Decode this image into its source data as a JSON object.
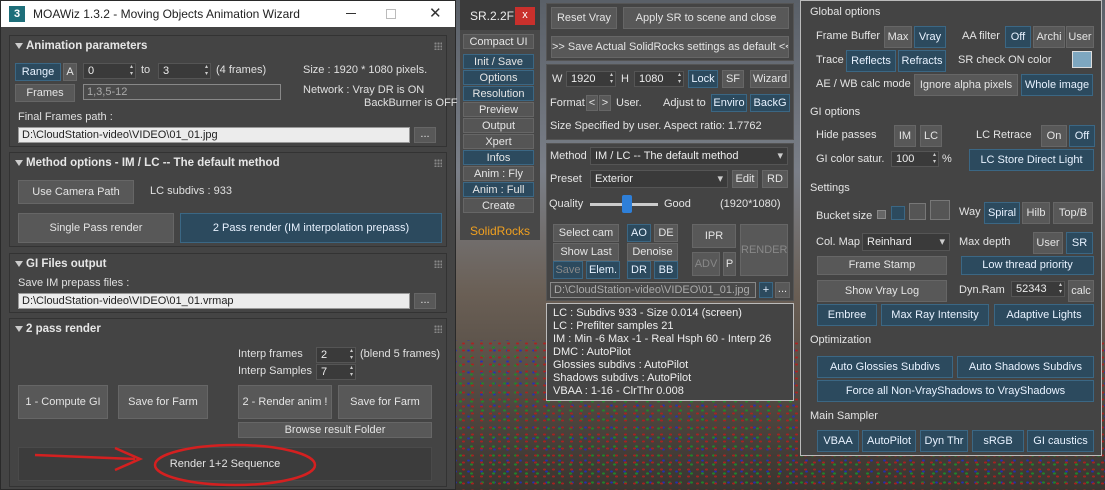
{
  "moawiz": {
    "title": "MOAWiz 1.3.2 - Moving Objects Animation Wizard",
    "app_icon": "3",
    "sections": {
      "anim": "Animation parameters",
      "method": "Method options - IM / LC -- The default method",
      "gi": "GI Files output",
      "two": "2 pass render"
    },
    "range_btn": "Range",
    "a_btn": "A",
    "range_from": "0",
    "to_lbl": "to",
    "range_to": "3",
    "frames_count": "(4 frames)",
    "size_text": "Size : 1920 * 1080 pixels.",
    "frames_btn": "Frames",
    "frames_placeholder": "1,3,5-12",
    "network1": "Network : Vray DR is ON",
    "network2": "BackBurner is OFF",
    "final_path_lbl": "Final Frames path :",
    "final_path": "D:\\CloudStation-video\\VIDEO\\01_01.jpg",
    "browse": "...",
    "use_camera_path": "Use Camera Path",
    "lc_subdivs": "LC subdivs : 933",
    "single_pass": "Single Pass render",
    "two_pass": "2 Pass render (IM interpolation prepass)",
    "save_im_lbl": "Save IM prepass files :",
    "im_path": "D:\\CloudStation-video\\VIDEO\\01_01.vrmap",
    "interp_frames_lbl": "Interp frames",
    "interp_frames": "2",
    "blend": "(blend 5 frames)",
    "interp_samples_lbl": "Interp Samples",
    "interp_samples": "7",
    "compute_gi": "1 - Compute GI",
    "save_farm1": "Save for Farm",
    "render_anim": "2 - Render anim !",
    "save_farm2": "Save for Farm",
    "browse_result": "Browse result Folder",
    "render_seq": "Render 1+2 Sequence"
  },
  "sr": {
    "title": "SR.2.2F",
    "close": "x",
    "items": [
      "Compact UI",
      "Init / Save",
      "Options",
      "Resolution",
      "Preview",
      "Output",
      "Xpert",
      "Infos",
      "Anim : Fly",
      "Anim : Full",
      "Create"
    ],
    "logo": "SolidRocks"
  },
  "mid": {
    "reset": "Reset Vray",
    "apply": "Apply SR to scene and close",
    "save_actual": ">> Save Actual SolidRocks settings as default <<",
    "w_lbl": "W",
    "w": "1920",
    "h_lbl": "H",
    "h": "1080",
    "lock": "Lock",
    "sf": "SF",
    "wizard": "Wizard",
    "format_lbl": "Format",
    "fmt_l": "<",
    "fmt_r": ">",
    "user_lbl": "User.",
    "adjust_lbl": "Adjust to",
    "enviro": "Enviro",
    "backg": "BackG",
    "size_text": "Size  Specified by user. Aspect ratio: 1.7762",
    "method_lbl": "Method",
    "method": "IM / LC -- The default method",
    "preset_lbl": "Preset",
    "preset": "Exterior",
    "edit": "Edit",
    "rd": "RD",
    "quality_lbl": "Quality",
    "good": "Good",
    "res": "(1920*1080)",
    "quality": 0.55,
    "select_cam": "Select cam",
    "ao": "AO",
    "de": "DE",
    "ipr": "IPR",
    "render": "RENDER",
    "show_last": "Show Last",
    "denoise": "Denoise",
    "save": "Save",
    "elem": "Elem.",
    "dr": "DR",
    "bb": "BB",
    "adv": "ADV",
    "p": "P",
    "path": "D:\\CloudStation-video\\VIDEO\\01_01.jpg",
    "plus": "+",
    "dots": "...",
    "info": [
      "LC : Subdivs 933 - Size 0.014 (screen)",
      "LC : Prefilter samples 21",
      "IM : Min -6 Max -1 - Real Hsph 60 - Interp 26",
      "DMC : AutoPilot",
      "Glossies subdivs : AutoPilot",
      "Shadows subdivs : AutoPilot",
      "VBAA : 1-16 - ClrThr 0.008"
    ]
  },
  "right": {
    "global": "Global options",
    "fb_lbl": "Frame Buffer",
    "max": "Max",
    "vray": "Vray",
    "aa_lbl": "AA filter",
    "off": "Off",
    "archi": "Archi",
    "user": "User",
    "trace_lbl": "Trace",
    "reflects": "Reflects",
    "refracts": "Refracts",
    "sr_check": "SR check ON color",
    "ae_lbl": "AE / WB calc mode",
    "ignore_alpha": "Ignore alpha pixels",
    "whole_image": "Whole image",
    "gi_options": "GI options",
    "hide_passes": "Hide passes",
    "im": "IM",
    "lc": "LC",
    "lc_retrace": "LC Retrace",
    "on": "On",
    "off2": "Off",
    "gi_satur": "GI color satur.",
    "satur": "100",
    "pct": "%",
    "lc_store": "LC Store Direct Light",
    "settings": "Settings",
    "bucket": "Bucket size",
    "way": "Way",
    "spiral": "Spiral",
    "hilb": "Hilb",
    "topb": "Top/B",
    "colmap": "Col. Map",
    "reinhard": "Reinhard",
    "maxdepth": "Max depth",
    "user2": "User",
    "sr": "SR",
    "frame_stamp": "Frame Stamp",
    "low_thread": "Low thread priority",
    "show_log": "Show Vray Log",
    "dynram_lbl": "Dyn.Ram",
    "dynram": "52343",
    "calc": "calc",
    "embree": "Embree",
    "max_ray": "Max Ray Intensity",
    "adaptive": "Adaptive Lights",
    "optimization": "Optimization",
    "auto_gloss": "Auto Glossies Subdivs",
    "auto_shadow": "Auto Shadows Subdivs",
    "force": "Force all Non-VrayShadows to VrayShadows",
    "main_sampler": "Main Sampler",
    "vbaa": "VBAA",
    "autopilot": "AutoPilot",
    "dynthr": "Dyn Thr",
    "srgb": "sRGB",
    "gi_caustics": "GI caustics",
    "sr_check_color": "#7ea7c0"
  },
  "colors": {
    "accent": "#2c4a5e",
    "annotation": "#d42020"
  }
}
